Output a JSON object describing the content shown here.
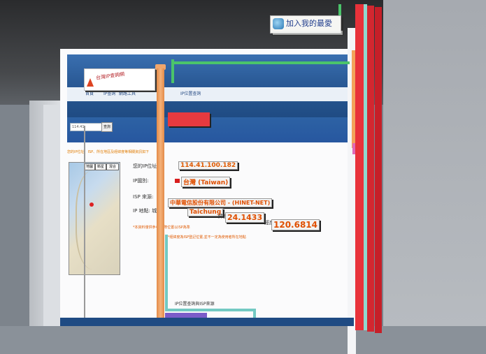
{
  "favorites": {
    "label": "加入我的最愛"
  },
  "logo": {
    "label": "台灣IP查詢網"
  },
  "nav": {
    "items": [
      "首頁",
      "IP查詢",
      "網路工具",
      "IP位置查詢"
    ]
  },
  "search": {
    "value": "114.41",
    "button": "查詢"
  },
  "notice": "您的IP位址、ISP、所在地區及經緯度等相關資訊如下",
  "map": {
    "buttons": [
      "地圖",
      "衛星",
      "混合"
    ]
  },
  "rows": {
    "ip_label": "您的IP位址:",
    "ip_value": "114.41.100.182",
    "country_label": "IP國別:",
    "country_value": "台灣 (Taiwan)",
    "isp_label": "ISP 來源:",
    "isp_value": "中華電信股份有限公司 - (HINET-NET)",
    "city_label": "IP 地點: 城市",
    "city_value": "Taichung",
    "lat_label": "緯度",
    "lat_value": "24.1433",
    "lng_label": "經度",
    "lng_value": "120.6814"
  },
  "warnings": {
    "w1": "*本資料僅供參考,實際位置以ISP為準",
    "w2": "*經緯度為ISP登記位置,並不一定為使用者所在地點"
  },
  "footer": {
    "line1": "IP位置查詢與ISP來源"
  }
}
